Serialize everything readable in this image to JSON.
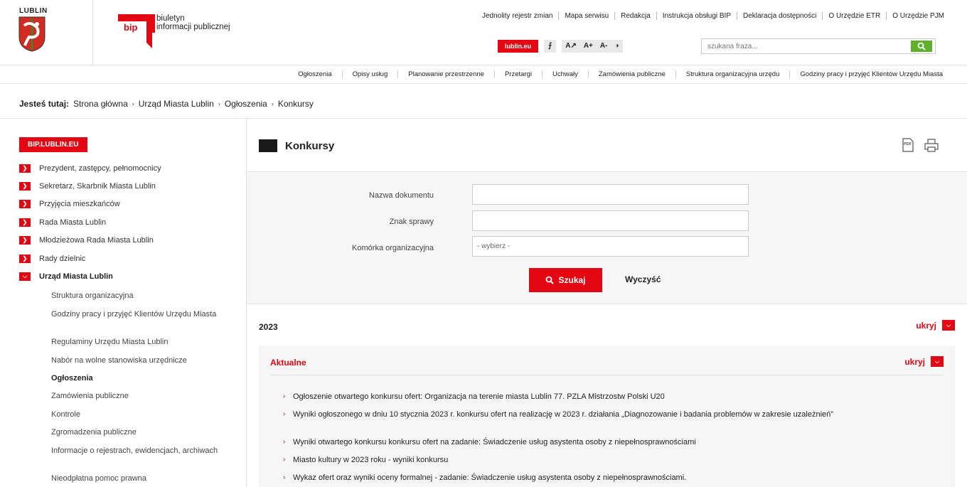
{
  "header": {
    "crest_title": "LUBLIN",
    "bip_line1": "biuletyn",
    "bip_line2": "informacji publicznej",
    "bip_logo_text": "bip",
    "top_links": [
      "Jednolity rejestr zmian",
      "Mapa serwisu",
      "Redakcja",
      "Instrukcja obsługi BIP",
      "Deklaracja dostępności",
      "O Urzędzie ETR",
      "O Urzędzie PJM"
    ],
    "lublin_button": "lublin.eu",
    "rss_icon": "rss-icon",
    "tool_labels": [
      "A+",
      "A-"
    ],
    "contrast_icon": "contrast-icon",
    "search_placeholder": "szukana fraza...",
    "brand_red": "#e30613",
    "search_green": "#5fb12b"
  },
  "nav": {
    "items": [
      "Ogłoszenia",
      "Opisy usług",
      "Planowanie przestrzenne",
      "Przetargi",
      "Uchwały",
      "Zamówienia publiczne",
      "Struktura organizacyjna urzędu",
      "Godziny pracy i przyjęć Klientów Urzędu Miasta"
    ]
  },
  "breadcrumb": {
    "lead": "Jesteś tutaj:",
    "items": [
      "Strona główna",
      "Urząd Miasta Lublin",
      "Ogłoszenia",
      "Konkursy"
    ]
  },
  "sidebar": {
    "badge": "BIP.LUBLIN.EU",
    "items": [
      {
        "label": "Prezydent, zastępcy, pełnomocnicy",
        "open": false
      },
      {
        "label": "Sekretarz, Skarbnik Miasta Lublin",
        "open": false
      },
      {
        "label": "Przyjęcia mieszkańców",
        "open": false
      },
      {
        "label": "Rada Miasta Lublin",
        "open": false
      },
      {
        "label": "Młodzieżowa Rada Miasta Lublin",
        "open": false
      },
      {
        "label": "Rady dzielnic",
        "open": false
      },
      {
        "label": "Urząd Miasta Lublin",
        "open": true
      }
    ],
    "subitems": [
      "Struktura organizacyjna",
      "Godziny pracy i przyjęć Klientów Urzędu Miasta",
      "Regulaminy Urzędu Miasta Lublin",
      "Nabór na wolne stanowiska urzędnicze",
      "Ogłoszenia",
      "Zamówienia publiczne",
      "Kontrole",
      "Zgromadzenia publiczne",
      "Informacje o rejestrach, ewidencjach, archiwach",
      "Nieodpłatna pomoc prawna"
    ],
    "current_subitem": "Ogłoszenia"
  },
  "content": {
    "title": "Konkursy",
    "form": {
      "doc_name_label": "Nazwa dokumentu",
      "doc_name_value": "",
      "case_label": "Znak sprawy",
      "case_value": "",
      "unit_label": "Komórka organizacyjna",
      "unit_value": "- wybierz -",
      "search_button": "Szukaj",
      "clear_button": "Wyczyść"
    },
    "year": "2023",
    "hide_label": "ukryj",
    "section": "Aktualne",
    "section_hide": "ukryj",
    "items": [
      "Ogłoszenie otwartego konkursu ofert: Organizacja na terenie miasta Lublin 77. PZLA Mistrzostw Polski U20",
      "Wyniki ogłoszonego w dniu 10 stycznia 2023 r. konkursu ofert na realizację w 2023 r. działania „Diagnozowanie i badania problemów w zakresie uzależnień”",
      "Wyniki otwartego konkursu konkursu ofert na zadanie: Świadczenie usług asystenta osoby z niepełnosprawnościami",
      "Miasto kultury w 2023 roku - wyniki konkursu",
      "Wykaz ofert oraz wyniki oceny formalnej - zadanie: Świadczenie usług asystenta osoby z niepełnosprawnościami."
    ]
  }
}
